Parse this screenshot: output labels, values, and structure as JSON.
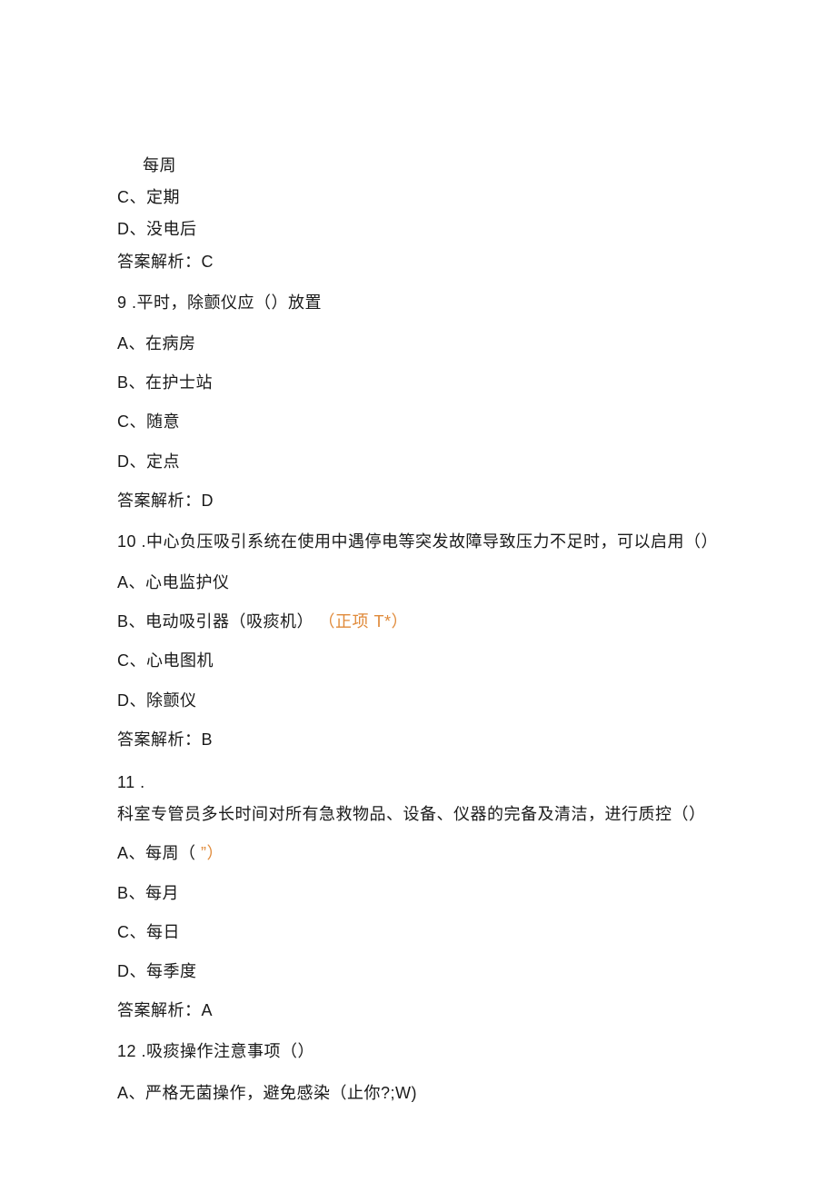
{
  "stray": {
    "line1": "每周"
  },
  "q8": {
    "optC": "C、定期",
    "optD": "D、没电后",
    "answer": "答案解析：C"
  },
  "q9": {
    "text": "9  .平时，除颤仪应（）放置",
    "optA": "A、在病房",
    "optB": "B、在护士站",
    "optC": "C、随意",
    "optD": "D、定点",
    "answer": "答案解析：D"
  },
  "q10": {
    "text": "10  .中心负压吸引系统在使用中遇停电等突发故障导致压力不足时，可以启用（）",
    "optA": "A、心电监护仪",
    "optB_main": "B、电动吸引器（吸痰机）",
    "optB_hint": "（正项 T*）",
    "optC": "C、心电图机",
    "optD": "D、除颤仪",
    "answer": "答案解析：B"
  },
  "q11": {
    "num": "11  .",
    "text": "科室专管员多长时间对所有急救物品、设备、仪器的完备及清洁，进行质控（）",
    "optA_main": "A、每周（     ",
    "optA_hint": "”）",
    "optB": "B、每月",
    "optC": "C、每日",
    "optD": "D、每季度",
    "answer": "答案解析：A"
  },
  "q12": {
    "text": "12  .吸痰操作注意事项（）",
    "optA": "A、严格无菌操作，避免感染（止你?;W)"
  }
}
